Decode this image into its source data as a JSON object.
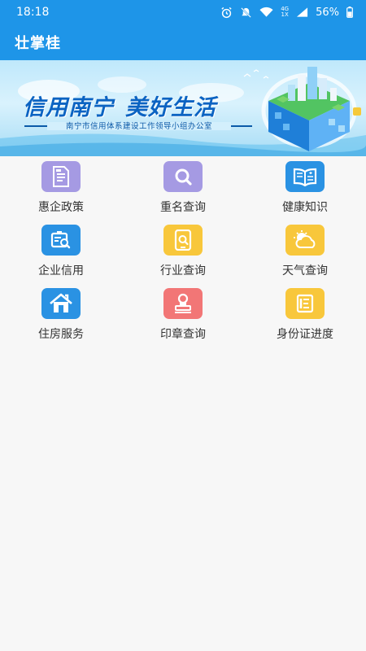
{
  "status_bar": {
    "time": "18:18",
    "network_top": "4G",
    "network_bottom": "1X",
    "battery": "56%",
    "icons": [
      "alarm-icon",
      "mute-icon",
      "wifi-icon",
      "signal-icon",
      "battery-icon"
    ]
  },
  "app_bar": {
    "title": "壮掌桂"
  },
  "banner": {
    "headline_left": "信用南宁",
    "headline_right": "美好生活",
    "subtitle": "南宁市信用体系建设工作领导小组办公室"
  },
  "services": [
    {
      "label": "惠企政策",
      "icon": "policy-document-icon",
      "color": "#a59ae3"
    },
    {
      "label": "重名查询",
      "icon": "search-icon",
      "color": "#a59ae3"
    },
    {
      "label": "健康知识",
      "icon": "book-icon",
      "color": "#2a92e3"
    },
    {
      "label": "企业信用",
      "icon": "enterprise-credit-icon",
      "color": "#2a92e3"
    },
    {
      "label": "行业查询",
      "icon": "industry-search-icon",
      "color": "#f8c73b"
    },
    {
      "label": "天气查询",
      "icon": "weather-icon",
      "color": "#f8c73b"
    },
    {
      "label": "住房服务",
      "icon": "house-icon",
      "color": "#2a92e3"
    },
    {
      "label": "印章查询",
      "icon": "seal-icon",
      "color": "#f27676"
    },
    {
      "label": "身份证进度",
      "icon": "id-card-progress-icon",
      "color": "#f8c73b"
    }
  ]
}
